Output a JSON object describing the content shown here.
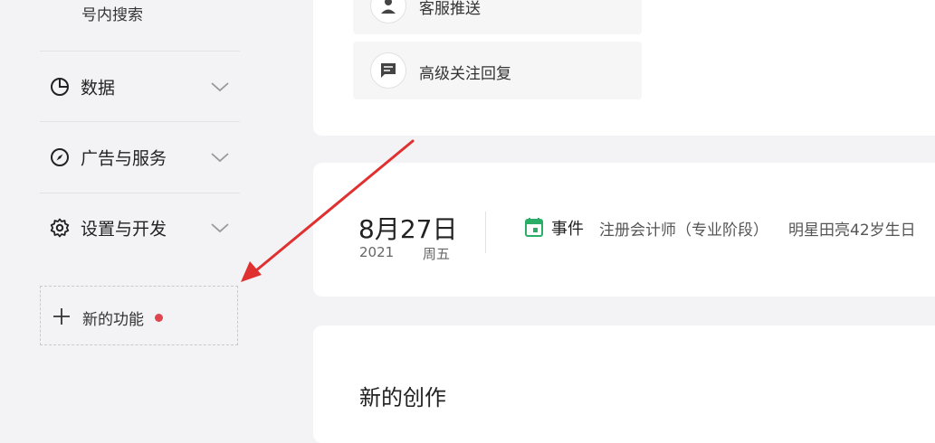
{
  "sidebar": {
    "search_item": "号内搜索",
    "items": [
      {
        "label": "数据",
        "icon": "pie-chart-icon"
      },
      {
        "label": "广告与服务",
        "icon": "compass-icon"
      },
      {
        "label": "设置与开发",
        "icon": "gear-icon"
      }
    ],
    "new_feature": {
      "label": "新的功能",
      "badge_color": "#e0464e"
    }
  },
  "top_card": {
    "items": [
      {
        "label": "客服推送",
        "icon": "customer-service-icon"
      },
      {
        "label": "高级关注回复",
        "icon": "message-icon"
      }
    ]
  },
  "date_card": {
    "date": "8月27日",
    "year": "2021",
    "weekday": "周五",
    "event_label": "事件",
    "event_icon_color": "#2aae67",
    "events": [
      "注册会计师（专业阶段）",
      "明星田亮42岁生日"
    ]
  },
  "create_card": {
    "title": "新的创作"
  },
  "annotation": {
    "arrow_color": "#e03131"
  }
}
